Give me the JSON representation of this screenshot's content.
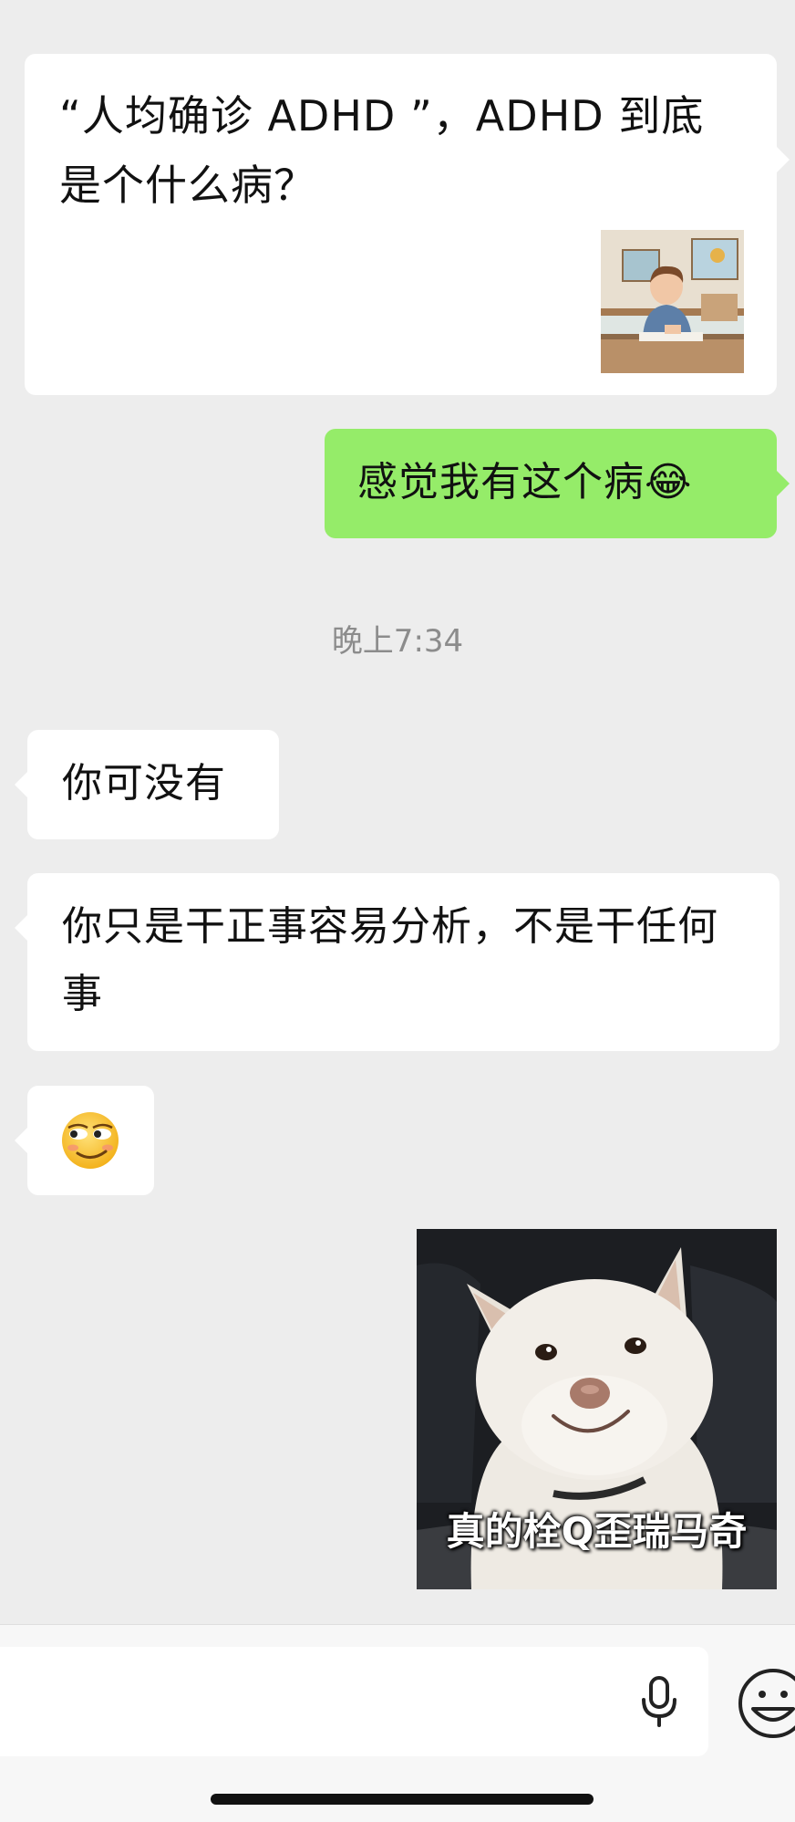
{
  "messages": {
    "article_card": {
      "title": "“人均确诊 ADHD ”，ADHD 到底是个什么病？"
    },
    "out_1": {
      "text": "感觉我有这个病😂"
    },
    "timestamp": "晚上7:34",
    "in_1": {
      "text": "你可没有"
    },
    "in_2": {
      "text": "你只是干正事容易分析，不是干任何事"
    },
    "in_3": {
      "emoji": "smirking-face-icon"
    },
    "sticker": {
      "caption": "真的栓Q歪瑞马奇"
    }
  },
  "input_bar": {
    "voice_icon": "microphone-icon",
    "emoji_icon": "smiley-face-icon"
  },
  "colors": {
    "background": "#ededed",
    "incoming_bubble": "#ffffff",
    "outgoing_bubble": "#95ec69",
    "timestamp_text": "#8c8c8c"
  }
}
